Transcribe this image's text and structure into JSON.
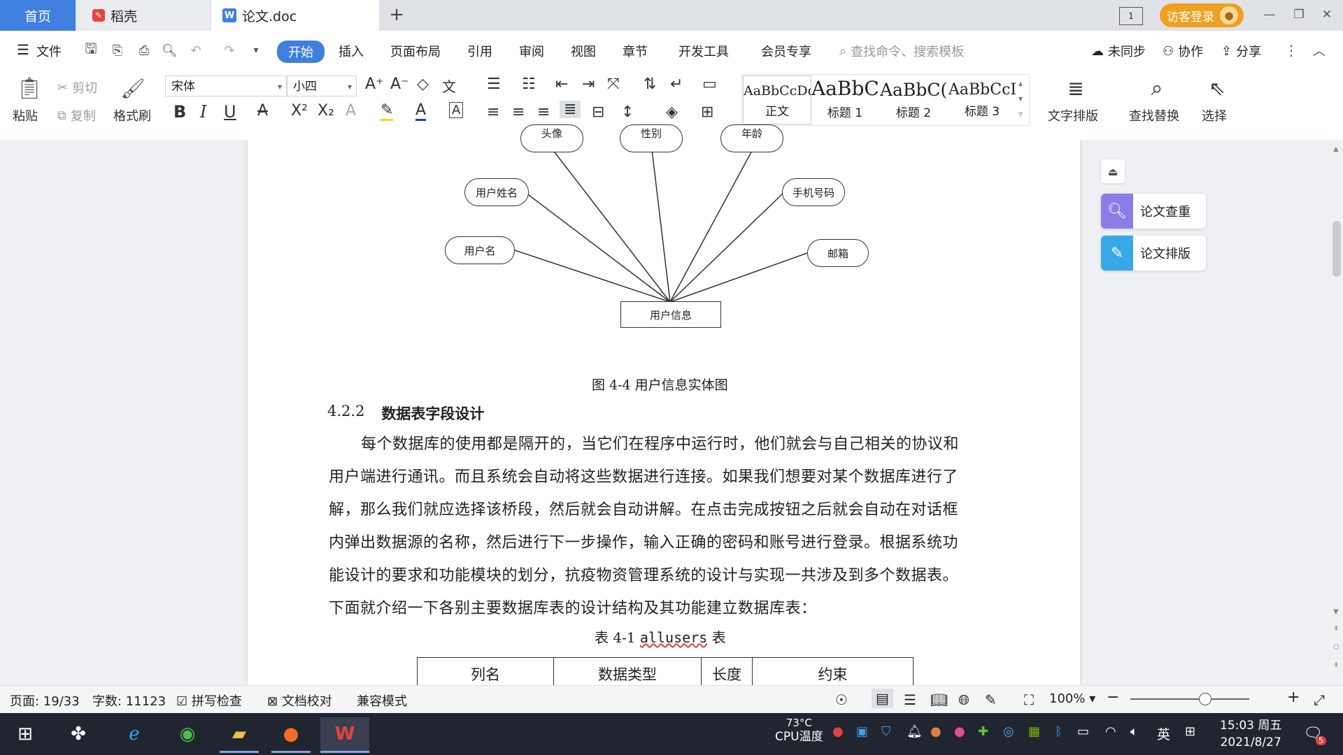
{
  "tabs": {
    "home": "首页",
    "daoke": "稻壳",
    "doc": "论文.doc",
    "new_tab": "+"
  },
  "titlebar": {
    "login": "访客登录",
    "minimize": "—",
    "restore": "❐",
    "close": "✕"
  },
  "menu": {
    "file": "文件",
    "start": "开始",
    "insert": "插入",
    "layout": "页面布局",
    "reference": "引用",
    "review": "审阅",
    "view": "视图",
    "chapter": "章节",
    "devtools": "开发工具",
    "member": "会员专享",
    "search_placeholder": "查找命令、搜索模板",
    "unsync": "未同步",
    "collab": "协作",
    "share": "分享"
  },
  "ribbon": {
    "paste": "粘贴",
    "cut": "剪切",
    "copy": "复制",
    "format_painter": "格式刷",
    "font": "宋体",
    "size": "小四",
    "styles": [
      {
        "sample": "AaBbCcDd",
        "name": "正文"
      },
      {
        "sample": "AaBbC",
        "name": "标题 1"
      },
      {
        "sample": "AaBbC(",
        "name": "标题 2"
      },
      {
        "sample": "AaBbCcI",
        "name": "标题 3"
      }
    ],
    "text_layout": "文字排版",
    "find_replace": "查找替换",
    "select": "选择"
  },
  "diagram": {
    "top_nodes": [
      "头像",
      "性别",
      "年龄"
    ],
    "user_realname": "用户姓名",
    "username": "用户名",
    "phone": "手机号码",
    "email": "邮箱",
    "entity": "用户信息",
    "caption": "图 4-4 用户信息实体图"
  },
  "section": {
    "number": "4.2.2",
    "title": "数据表字段设计"
  },
  "paragraph": [
    "每个数据库的使用都是隔开的，当它们在程序中运行时，他们就会与自己相关的协议和",
    "用户端进行通讯。而且系统会自动将这些数据进行连接。如果我们想要对某个数据库进行了",
    "解，那么我们就应选择该桥段，然后就会自动讲解。在点击完成按钮之后就会自动在对话框",
    "内弹出数据源的名称，然后进行下一步操作，输入正确的密码和账号进行登录。根据系统功",
    "能设计的要求和功能模块的划分，抗疫物资管理系统的设计与实现一共涉及到多个数据表。",
    "下面就介绍一下各别主要数据库表的设计结构及其功能建立数据库表："
  ],
  "table": {
    "caption_prefix": "表 4-1 ",
    "caption_name": "allusers",
    "caption_suffix": " 表",
    "headers": [
      "列名",
      "数据类型",
      "长度",
      "约束"
    ]
  },
  "side_panel": {
    "check": "论文查重",
    "layout": "论文排版"
  },
  "status": {
    "page": "页面: 19/33",
    "words": "字数: 11123",
    "spell": "拼写检查",
    "proof": "文档校对",
    "compat": "兼容模式",
    "zoom": "100%"
  },
  "taskbar": {
    "temp": "73°C",
    "cpu": "CPU温度",
    "ime": "英",
    "time": "15:03 周五",
    "date": "2021/8/27",
    "notif": "5"
  },
  "colors": {
    "accent": "#3f7fe0",
    "login": "#f0a020"
  }
}
